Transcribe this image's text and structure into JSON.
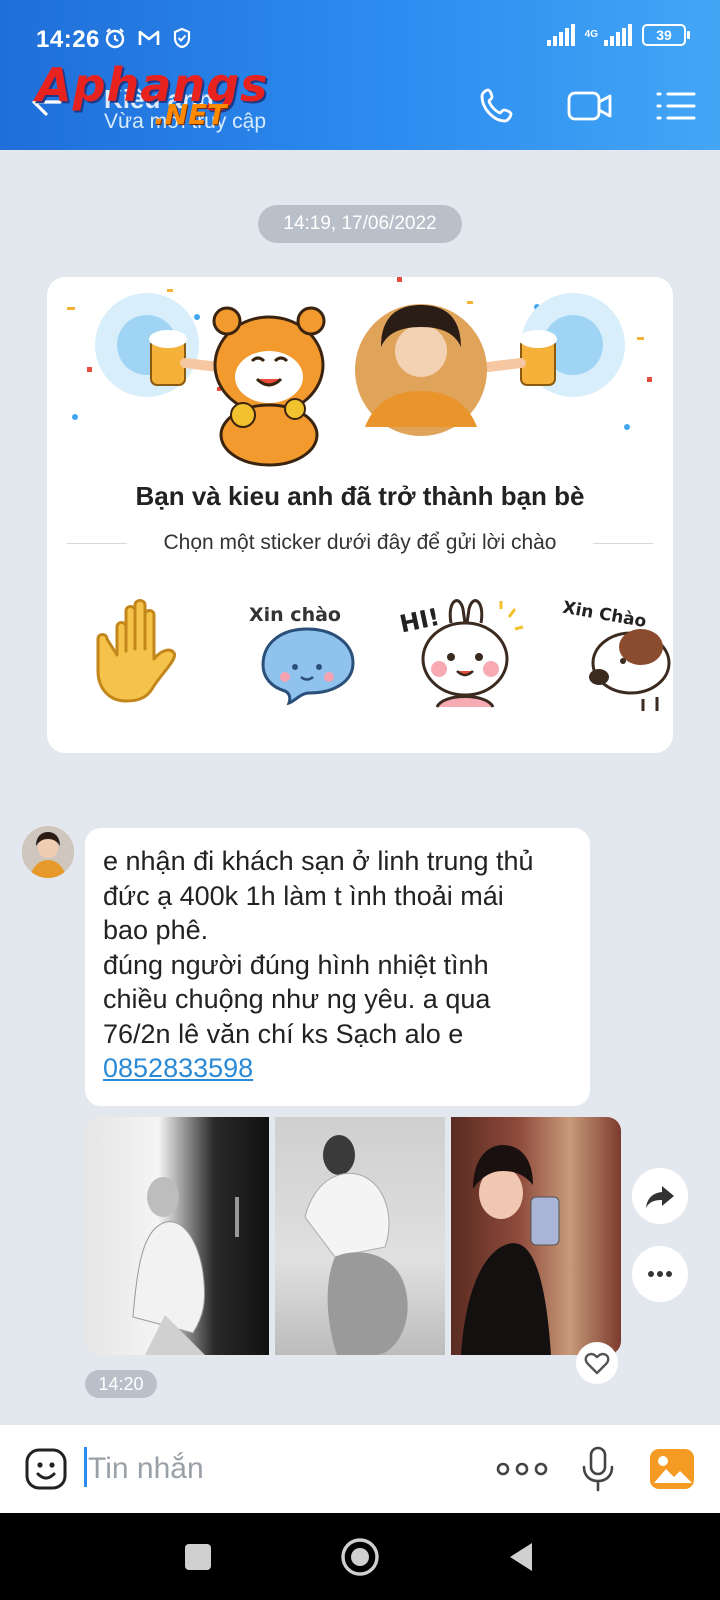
{
  "status_bar": {
    "time": "14:26",
    "network": "4G",
    "battery": "39"
  },
  "header": {
    "contact_name": "Kiều anh",
    "contact_status": "Vừa mới truy cập",
    "watermark_main": "Aphangs",
    "watermark_sub": ".NET"
  },
  "chat": {
    "date_separator": "14:19, 17/06/2022",
    "friend_card": {
      "title": "Bạn và kieu anh đã trở thành bạn bè",
      "subtitle": "Chọn một sticker dưới đây để gửi lời chào",
      "stickers": [
        {
          "icon": "waving-hand-icon",
          "caption": ""
        },
        {
          "icon": "blue-cat-sticker",
          "caption": "Xin chào"
        },
        {
          "icon": "bunny-sticker",
          "caption": "HI!"
        },
        {
          "icon": "dog-sticker",
          "caption": "Xin Chào"
        }
      ]
    },
    "message": {
      "lines": [
        "e nhận đi khách sạn ở linh trung thủ",
        "đức ạ 400k 1h làm t ình thoải mái",
        "bao phê.",
        "đúng người đúng hình nhiệt tình",
        "chiều chuộng như ng yêu. a qua",
        "76/2n lê văn chí ks Sạch alo e"
      ],
      "phone": "0852833598",
      "time": "14:20",
      "photo_count": 3
    }
  },
  "input_bar": {
    "placeholder": "Tin nhắn"
  },
  "colors": {
    "header_start": "#1f6fd8",
    "header_end": "#43a6f5",
    "link": "#2a8ad6",
    "chat_bg": "#e3e8ef"
  }
}
